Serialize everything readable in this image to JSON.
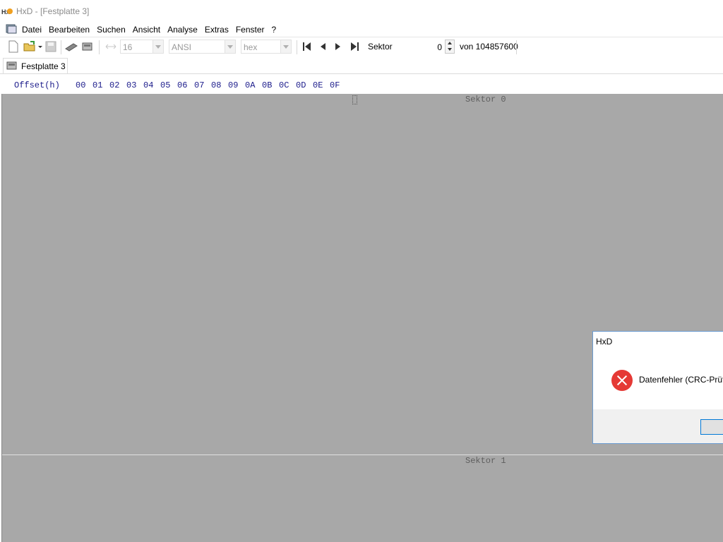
{
  "window": {
    "title": "HxD - [Festplatte 3]"
  },
  "menu": {
    "items": [
      "Datei",
      "Bearbeiten",
      "Suchen",
      "Ansicht",
      "Analyse",
      "Extras",
      "Fenster",
      "?"
    ]
  },
  "toolbar": {
    "bytes_per_row": "16",
    "charset": "ANSI",
    "offset_base": "hex",
    "sektor_label": "Sektor",
    "sektor_value": "0",
    "sektor_total": "von 104857600"
  },
  "tab": {
    "label": "Festplatte 3"
  },
  "editor": {
    "offset_header": "Offset(h)",
    "columns": [
      "00",
      "01",
      "02",
      "03",
      "04",
      "05",
      "06",
      "07",
      "08",
      "09",
      "0A",
      "0B",
      "0C",
      "0D",
      "0E",
      "0F"
    ],
    "sectors": [
      "Sektor 0",
      "Sektor 1"
    ]
  },
  "dialog": {
    "title": "HxD",
    "message": "Datenfehler (CRC-Prüf"
  },
  "colors": {
    "editor_bg": "#a8a8a8",
    "hex_header": "#1a1a8a",
    "error": "#e53935",
    "accent": "#0078d7"
  }
}
